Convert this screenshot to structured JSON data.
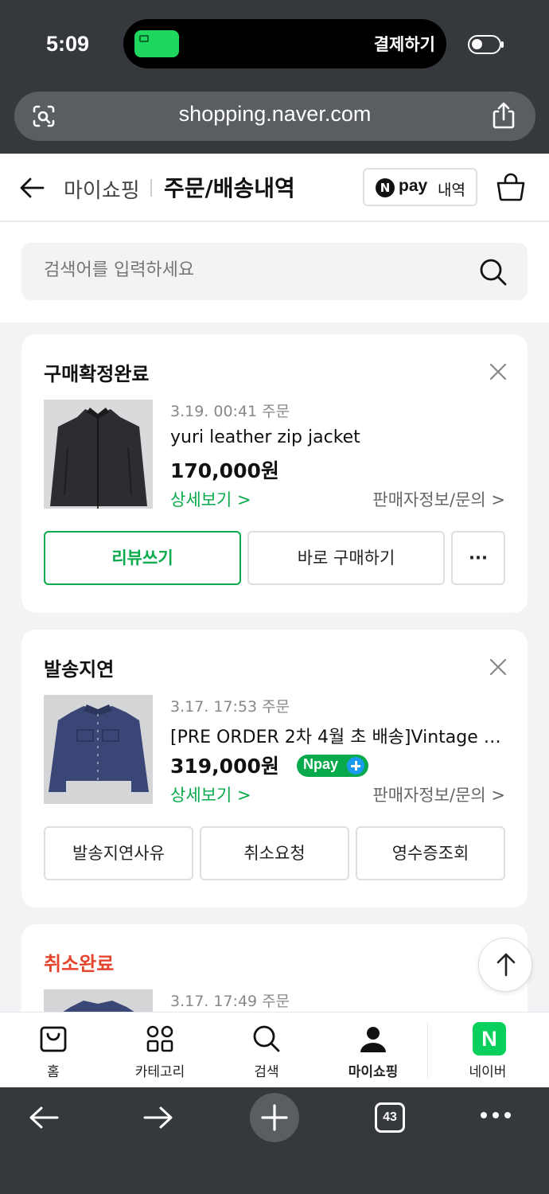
{
  "status_bar": {
    "time": "5:09",
    "island_text": "결제하기"
  },
  "browser": {
    "url": "shopping.naver.com",
    "tabs_count": "43"
  },
  "header": {
    "breadcrumb_parent": "마이쇼핑",
    "title": "주문/배송내역",
    "npay_mark": "N",
    "npay_pay": "pay",
    "npay_label": "내역"
  },
  "search": {
    "placeholder": "검색어를 입력하세요"
  },
  "orders": [
    {
      "status": "구매확정완료",
      "status_color": "#111111",
      "date": "3.19. 00:41 주문",
      "product": "yuri leather zip jacket",
      "price": "170,000원",
      "detail_link": "상세보기 >",
      "seller_link": "판매자정보/문의 >",
      "buttons": [
        "리뷰쓰기",
        "바로 구매하기",
        "···"
      ]
    },
    {
      "status": "발송지연",
      "status_color": "#111111",
      "date": "3.17. 17:53 주문",
      "product": "[PRE ORDER 2차 4월 초 배송]Vintage w...",
      "price": "319,000원",
      "npay_badge": "Npay",
      "detail_link": "상세보기 >",
      "seller_link": "판매자정보/문의 >",
      "buttons": [
        "발송지연사유",
        "취소요청",
        "영수증조회"
      ]
    },
    {
      "status": "취소완료",
      "status_color": "#e5452f",
      "date": "3.17. 17:49 주문"
    }
  ],
  "tabbar": {
    "items": [
      "홈",
      "카테고리",
      "검색",
      "마이쇼핑",
      "네이버"
    ],
    "active": "마이쇼핑",
    "naver_mark": "N"
  },
  "colors": {
    "accent": "#09aa4c",
    "cancel": "#e5452f",
    "chrome": "#35383c"
  }
}
